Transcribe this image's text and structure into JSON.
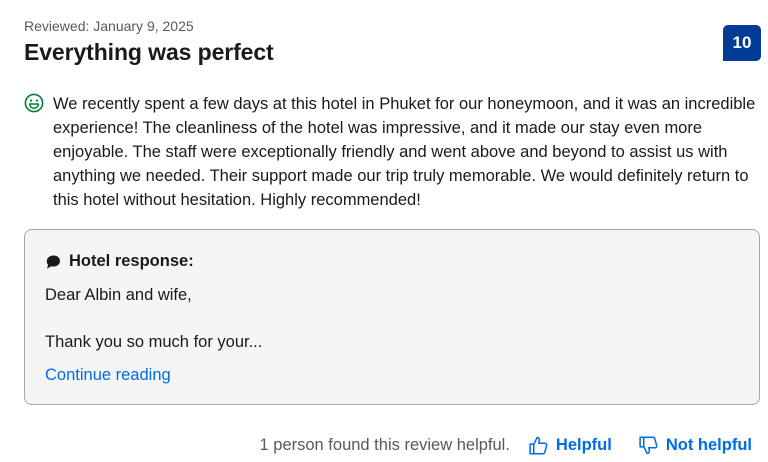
{
  "review": {
    "reviewed_date": "Reviewed: January 9, 2025",
    "title": "Everything was perfect",
    "score": "10",
    "positive_text": "We recently spent a few days at this hotel in Phuket for our honeymoon, and it was an incredible experience! The cleanliness of the hotel was impressive, and it made our stay even more enjoyable. The staff were exceptionally friendly and went above and beyond to assist us with anything we needed. Their support made our trip truly memorable. We would definitely return to this hotel without hesitation. Highly recommended!",
    "positive_icon": "smile-icon"
  },
  "hotel_response": {
    "label": "Hotel response:",
    "icon": "speech-bubble-icon",
    "greeting": "Dear Albin and wife,",
    "body": "Thank you so much for your...",
    "continue_label": "Continue reading"
  },
  "footer": {
    "helpful_count": "1 person found this review helpful.",
    "helpful_label": "Helpful",
    "not_helpful_label": "Not helpful"
  },
  "colors": {
    "score_bg": "#003b95",
    "link": "#006ce4",
    "positive_icon": "#008234",
    "response_bg": "#f5f5f5",
    "response_border": "#a6a6a6"
  }
}
